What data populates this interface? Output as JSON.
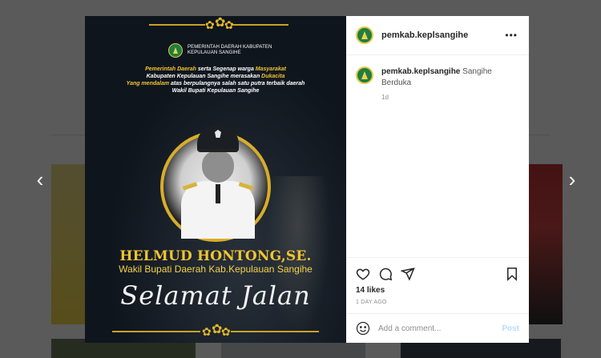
{
  "post": {
    "gov_header_line1": "PEMERINTAH DAERAH KABUPATEN",
    "gov_header_line2": "KEPULAUAN SANGIHE",
    "condolence": {
      "line1_a": "Pemerintah Daerah",
      "line1_b": " serta Segenap warga ",
      "line1_c": "Masyarakat",
      "line2_a": "Kabupaten Kepulauan Sangihe merasakan ",
      "line2_b": "Dukacita",
      "line3_a": "Yang mendalam",
      "line3_b": " atas berpulangnya salah satu putra terbaik daerah",
      "line4": "Wakil  Bupati Kepulauan Sangihe"
    },
    "name": "HELMUD HONTONG,SE.",
    "role": "Wakil Bupati Daerah Kab.Kepulauan Sangihe",
    "farewell": "Selamat Jalan"
  },
  "sidebar": {
    "username": "pemkab.keplsangihe",
    "more_icon": "more-horizontal-icon",
    "caption_user": "pemkab.keplsangihe",
    "caption_text": "Sangihe Berduka",
    "caption_time": "1d",
    "likes": "14 likes",
    "date": "1 DAY AGO",
    "comment_placeholder": "Add a comment...",
    "post_label": "Post"
  },
  "navigation": {
    "prev": "‹",
    "next": "›"
  },
  "colors": {
    "gold": "#f0c431",
    "post_link": "#b2dffc",
    "poster_bg": "#0f151d"
  }
}
